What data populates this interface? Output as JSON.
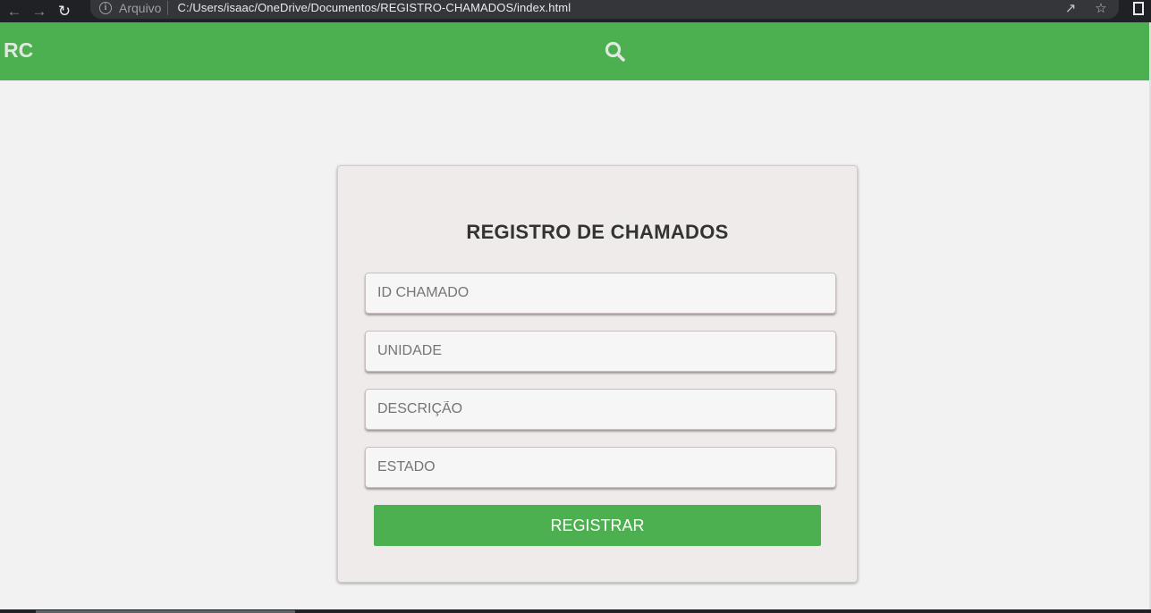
{
  "browser": {
    "back_icon": "arrow-left-icon",
    "forward_icon": "arrow-right-icon",
    "reload_icon": "reload-icon",
    "scheme_label": "Arquivo",
    "url": "C:/Users/isaac/OneDrive/Documentos/REGISTRO-CHAMADOS/index.html"
  },
  "header": {
    "logo": "RC",
    "background": "#4caf50"
  },
  "form": {
    "title": "REGISTRO DE CHAMADOS",
    "fields": [
      {
        "placeholder": "ID CHAMADO",
        "value": ""
      },
      {
        "placeholder": "UNIDADE",
        "value": ""
      },
      {
        "placeholder": "DESCRIÇÃO",
        "value": ""
      },
      {
        "placeholder": "ESTADO",
        "value": ""
      }
    ],
    "submit_label": "REGISTRAR",
    "accent": "#4caf50"
  }
}
